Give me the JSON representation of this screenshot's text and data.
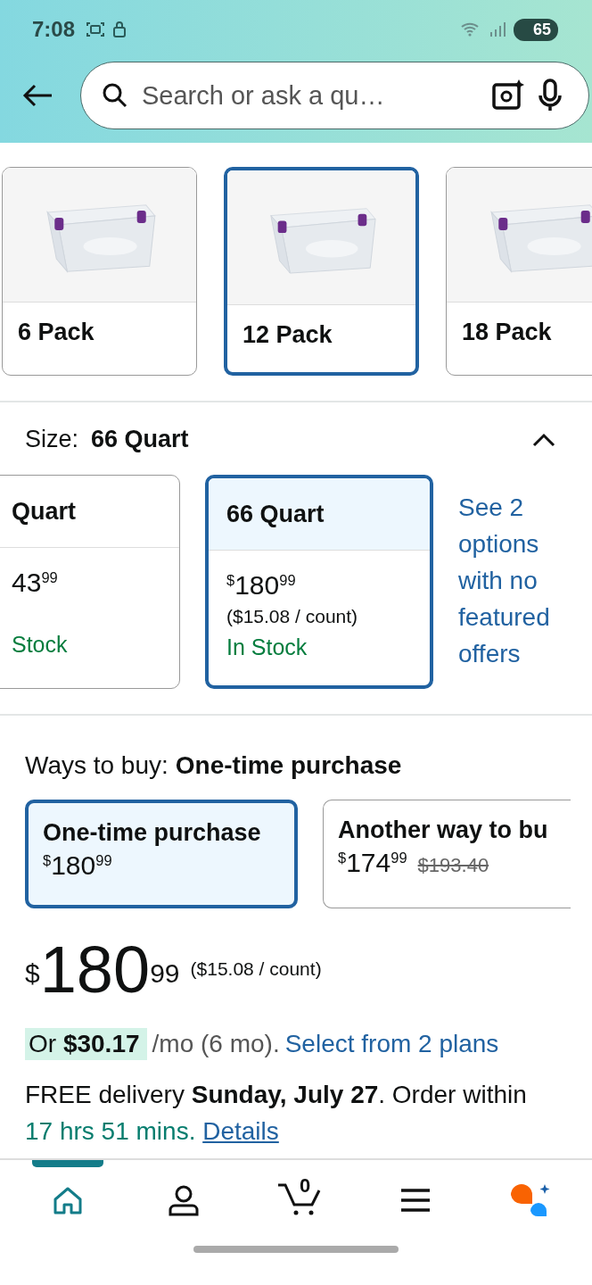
{
  "status_bar": {
    "time": "7:08",
    "battery": "65"
  },
  "search": {
    "placeholder": "Search or ask a qu…"
  },
  "packs": [
    {
      "label": "6 Pack",
      "selected": false
    },
    {
      "label": "12 Pack",
      "selected": true
    },
    {
      "label": "18 Pack",
      "selected": false
    }
  ],
  "size": {
    "label": "Size:",
    "value": "66 Quart",
    "expanded": true
  },
  "size_options": [
    {
      "name": "Quart",
      "whole": "43",
      "fraction": "99",
      "availability": "Stock",
      "selected": false
    },
    {
      "name": "66 Quart",
      "currency": "$",
      "whole": "180",
      "fraction": "99",
      "unit_price": "($15.08 / count)",
      "availability": "In Stock",
      "selected": true
    }
  ],
  "see_more": "See 2 options with no featured offers",
  "ways_to_buy": {
    "label": "Ways to buy:",
    "value": "One-time purchase",
    "options": [
      {
        "title": "One-time purchase",
        "currency": "$",
        "whole": "180",
        "fraction": "99",
        "selected": true
      },
      {
        "title": "Another way to bu",
        "currency": "$",
        "whole": "174",
        "fraction": "99",
        "list_price": "$193.40",
        "selected": false
      }
    ]
  },
  "price": {
    "currency": "$",
    "whole": "180",
    "fraction": "99",
    "unit_price": "($15.08 / count)"
  },
  "installment": {
    "offer": "Or **$30.17**",
    "terms": "/mo (6 mo).",
    "link": "Select from 2 plans"
  },
  "delivery": {
    "text": "FREE delivery **Sunday, July 27**. Order within",
    "countdown": "17 hrs 51 mins.",
    "link": "Details"
  },
  "nav": [
    {
      "kind": "home",
      "selected": true
    },
    {
      "kind": "account",
      "selected": false
    },
    {
      "kind": "cart",
      "selected": false,
      "count": "0"
    },
    {
      "kind": "menu",
      "selected": false
    },
    {
      "kind": "assistant",
      "selected": false
    }
  ]
}
